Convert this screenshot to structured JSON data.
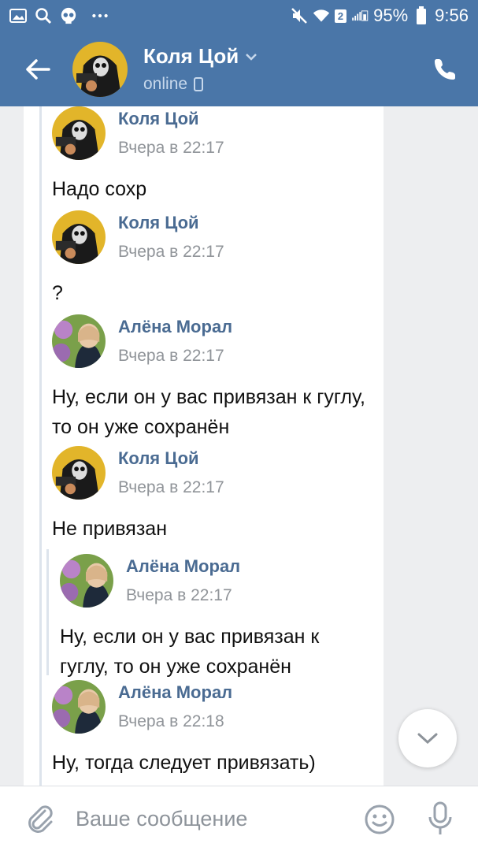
{
  "status_bar": {
    "battery": "95%",
    "time": "9:56",
    "sim_badge": "2",
    "icons": [
      "gallery-icon",
      "search-icon",
      "skull-icon",
      "more-dots-icon",
      "mute-icon",
      "wifi-icon",
      "signal-icon",
      "battery-icon"
    ]
  },
  "header": {
    "name": "Коля Цой",
    "status": "online",
    "icons": [
      "back-arrow-icon",
      "chevron-down-icon",
      "phone-icon",
      "mobile-icon"
    ]
  },
  "messages": [
    {
      "author": "Коля Цой",
      "time": "Вчера в 22:17",
      "text": "Надо сохр",
      "avatar": "kolya"
    },
    {
      "author": "Коля Цой",
      "time": "Вчера в 22:17",
      "text": "?",
      "avatar": "kolya"
    },
    {
      "author": "Алёна Морал",
      "time": "Вчера в 22:17",
      "text": "Ну, если он у вас привязан к гуглу, то он уже сохранён",
      "avatar": "alena"
    },
    {
      "author": "Коля Цой",
      "time": "Вчера в 22:17",
      "text": "Не привязан",
      "avatar": "kolya"
    },
    {
      "author": "Алёна Морал",
      "time": "Вчера в 22:17",
      "text": "Ну, если он у вас привязан к гуглу, то он уже сохранён",
      "avatar": "alena",
      "nested": true
    },
    {
      "author": "Алёна Морал",
      "time": "Вчера в 22:18",
      "text": "Ну, тогда следует привязать)",
      "avatar": "alena"
    }
  ],
  "input": {
    "placeholder": "Ваше сообщение",
    "value": ""
  },
  "colors": {
    "header_bg": "#4a76a8",
    "author": "#4a6b92",
    "time": "#909499",
    "chat_bg": "#edeef0"
  }
}
